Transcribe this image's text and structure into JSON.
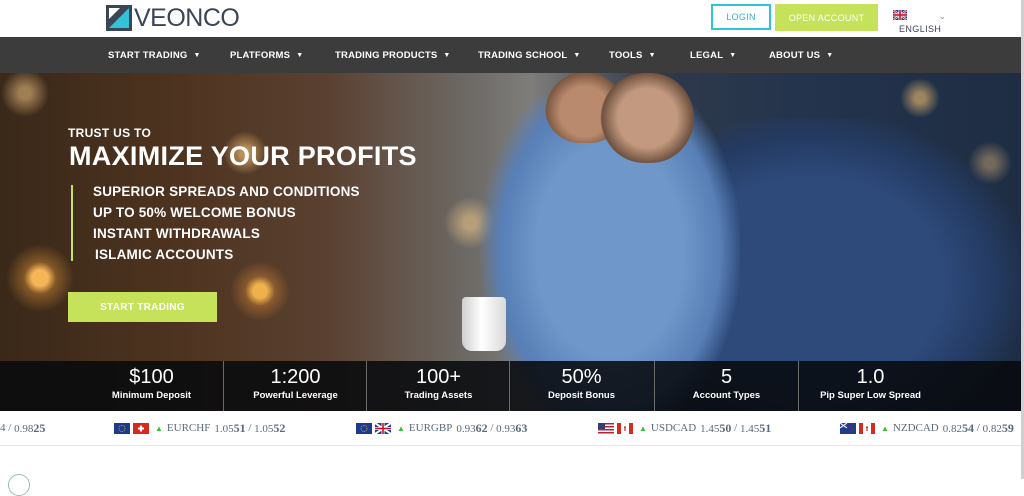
{
  "brand": {
    "name": "VEONCO",
    "accent": "#c5e25a",
    "teal": "#33c3d8"
  },
  "header": {
    "login_label": "LOGIN",
    "open_account_label": "OPEN ACCOUNT",
    "language_label": "ENGLISH"
  },
  "nav": {
    "items": [
      {
        "label": "START TRADING"
      },
      {
        "label": "PLATFORMS"
      },
      {
        "label": "TRADING PRODUCTS"
      },
      {
        "label": "TRADING SCHOOL"
      },
      {
        "label": "TOOLS"
      },
      {
        "label": "LEGAL"
      },
      {
        "label": "ABOUT US"
      }
    ]
  },
  "hero": {
    "kicker": "TRUST US TO",
    "title": "MAXIMIZE YOUR PROFITS",
    "bullets": [
      "SUPERIOR SPREADS AND CONDITIONS",
      "UP TO 50% WELCOME BONUS",
      "INSTANT WITHDRAWALS",
      "ISLAMIC ACCOUNTS"
    ],
    "cta_label": "START TRADING"
  },
  "stats": [
    {
      "value": "$100",
      "label": "Minimum Deposit"
    },
    {
      "value": "1:200",
      "label": "Powerful Leverage"
    },
    {
      "value": "100+",
      "label": "Trading Assets"
    },
    {
      "value": "50%",
      "label": "Deposit Bonus"
    },
    {
      "value": "5",
      "label": "Account Types"
    },
    {
      "value": "1.0",
      "label": "Pip Super Low Spread"
    }
  ],
  "ticker": [
    {
      "pair": "",
      "bid_a": "4",
      "bid_b": "",
      "ask_a": "0.98",
      "ask_b": "25"
    },
    {
      "pair": "EURCHF",
      "bid_a": "1.05",
      "bid_b": "51",
      "ask_a": "1.05",
      "ask_b": "52"
    },
    {
      "pair": "EURGBP",
      "bid_a": "0.93",
      "bid_b": "62",
      "ask_a": "0.93",
      "ask_b": "63"
    },
    {
      "pair": "USDCAD",
      "bid_a": "1.45",
      "bid_b": "50",
      "ask_a": "1.45",
      "ask_b": "51"
    },
    {
      "pair": "NZDCAD",
      "bid_a": "0.82",
      "bid_b": "54",
      "ask_a": "0.82",
      "ask_b": "59"
    }
  ]
}
